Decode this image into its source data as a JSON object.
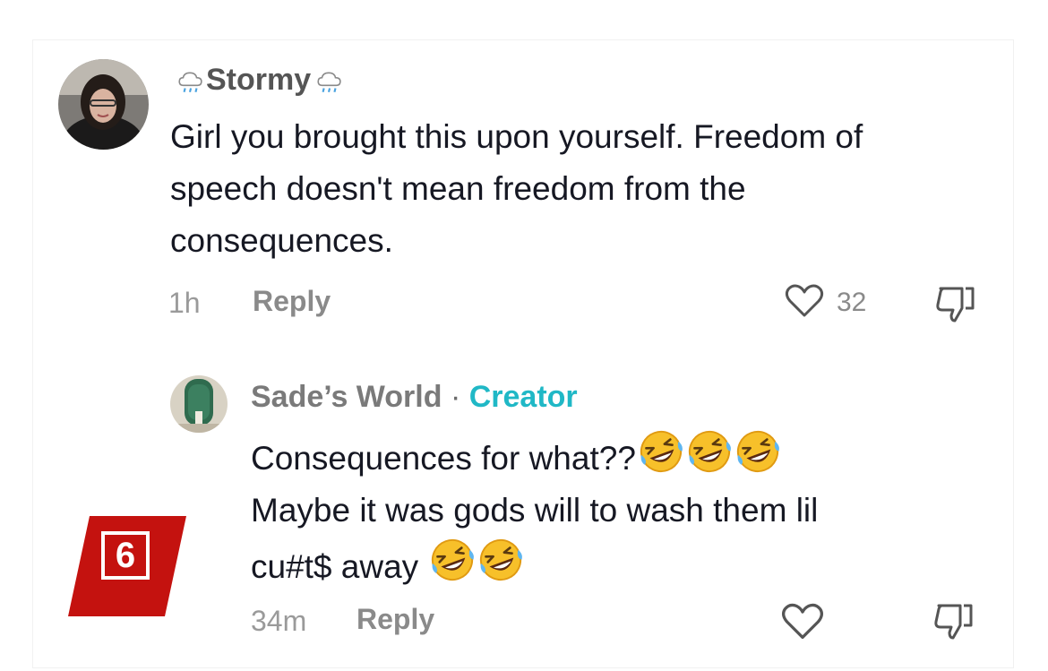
{
  "comment": {
    "username": "Stormy",
    "username_emoji": "rain-cloud-icon",
    "text": "Girl you brought this upon yourself. Freedom of speech doesn't mean freedom from the consequences.",
    "time": "1h",
    "reply_label": "Reply",
    "like_count": "32"
  },
  "reply": {
    "username": "Sade’s World",
    "separator": " · ",
    "role": "Creator",
    "line1": "Consequences for what??",
    "line2": "Maybe it was gods will to wash them lil",
    "line3": "cu#t$ away",
    "emoji": "rolling-on-the-floor-laughing-icon",
    "time": "34m",
    "reply_label": "Reply"
  },
  "badge": {
    "number": "6",
    "color": "#c4120f"
  },
  "colors": {
    "creator": "#20b8c6",
    "text": "#161823",
    "muted": "#8a8a8a"
  }
}
